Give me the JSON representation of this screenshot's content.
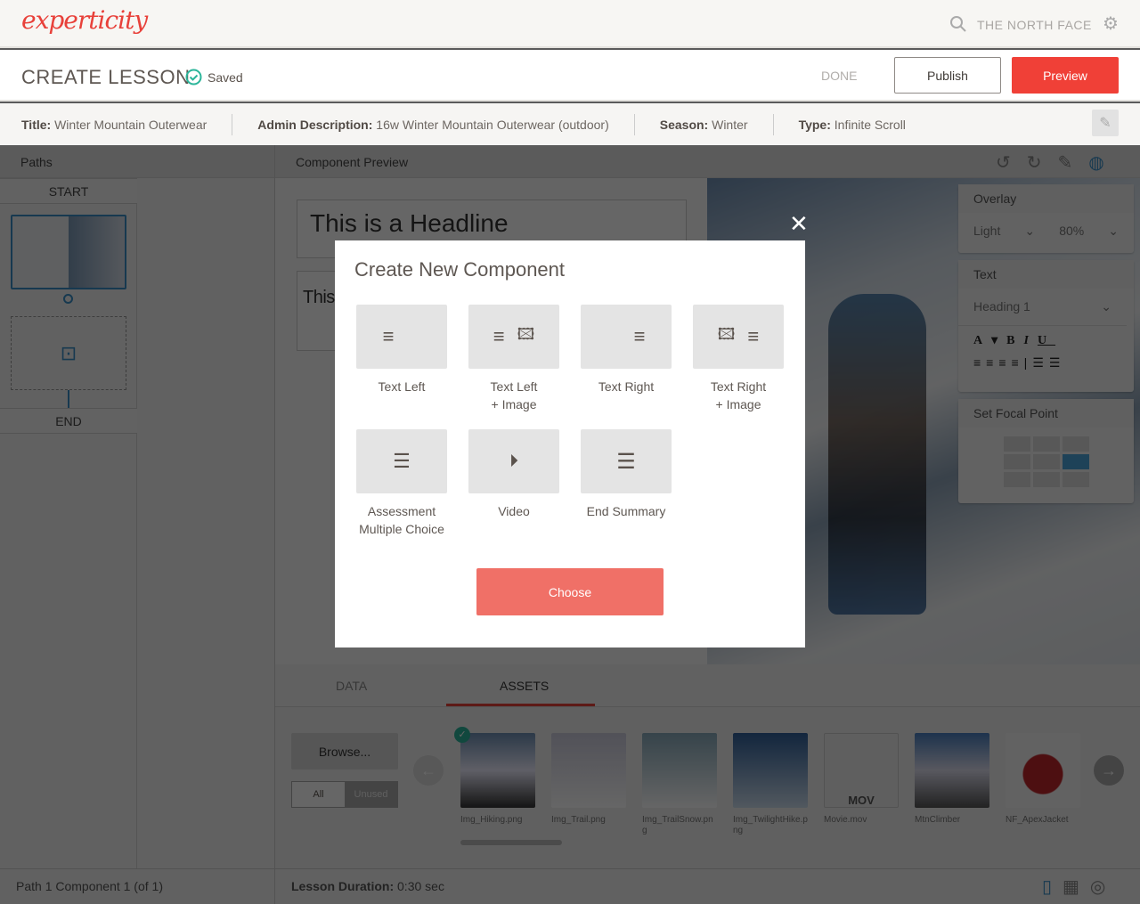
{
  "header": {
    "logo": "experticity",
    "brand": "THE NORTH FACE"
  },
  "lesson": {
    "title": "CREATE LESSON",
    "saved": "Saved",
    "done": "DONE",
    "publish": "Publish",
    "preview": "Preview"
  },
  "info": [
    {
      "k": "Title:",
      "v": "Winter Mountain Outerwear"
    },
    {
      "k": "Admin Description:",
      "v": "16w Winter Mountain Outerwear (outdoor)"
    },
    {
      "k": "Season:",
      "v": "Winter"
    },
    {
      "k": "Type:",
      "v": "Infinite Scroll"
    }
  ],
  "paths": {
    "header": "Paths",
    "start": "START",
    "end": "END"
  },
  "preview": {
    "header": "Component Preview",
    "headline": "This is a Headline",
    "sub": "This"
  },
  "overlay": {
    "title": "Overlay",
    "style": "Light",
    "opacity": "80%"
  },
  "text": {
    "title": "Text",
    "style": "Heading 1"
  },
  "focal": {
    "title": "Set Focal Point",
    "selected": "middle-right"
  },
  "tabs": {
    "data": "DATA",
    "assets": "ASSETS"
  },
  "assets": {
    "browse": "Browse...",
    "all": "All",
    "unused": "Unused",
    "items": [
      "Img_Hiking.png",
      "Img_Trail.png",
      "Img_TrailSnow.png",
      "Img_TwilightHike.png",
      "Movie.mov",
      "MtnClimber",
      "NF_ApexJacket"
    ]
  },
  "status": {
    "path": "Path 1 Component 1 (of 1)",
    "duration_label": "Lesson Duration:",
    "duration": "0:30 sec"
  },
  "modal": {
    "title": "Create New Component",
    "tiles": [
      "Text Left",
      "Text Left\n+ Image",
      "Text Right",
      "Text Right\n+ Image",
      "Assessment\nMultiple Choice",
      "Video",
      "End Summary"
    ],
    "choose": "Choose"
  },
  "colors": {
    "accent": "#f04037",
    "blue": "#3a8fc7",
    "saved": "#2bb59a"
  }
}
